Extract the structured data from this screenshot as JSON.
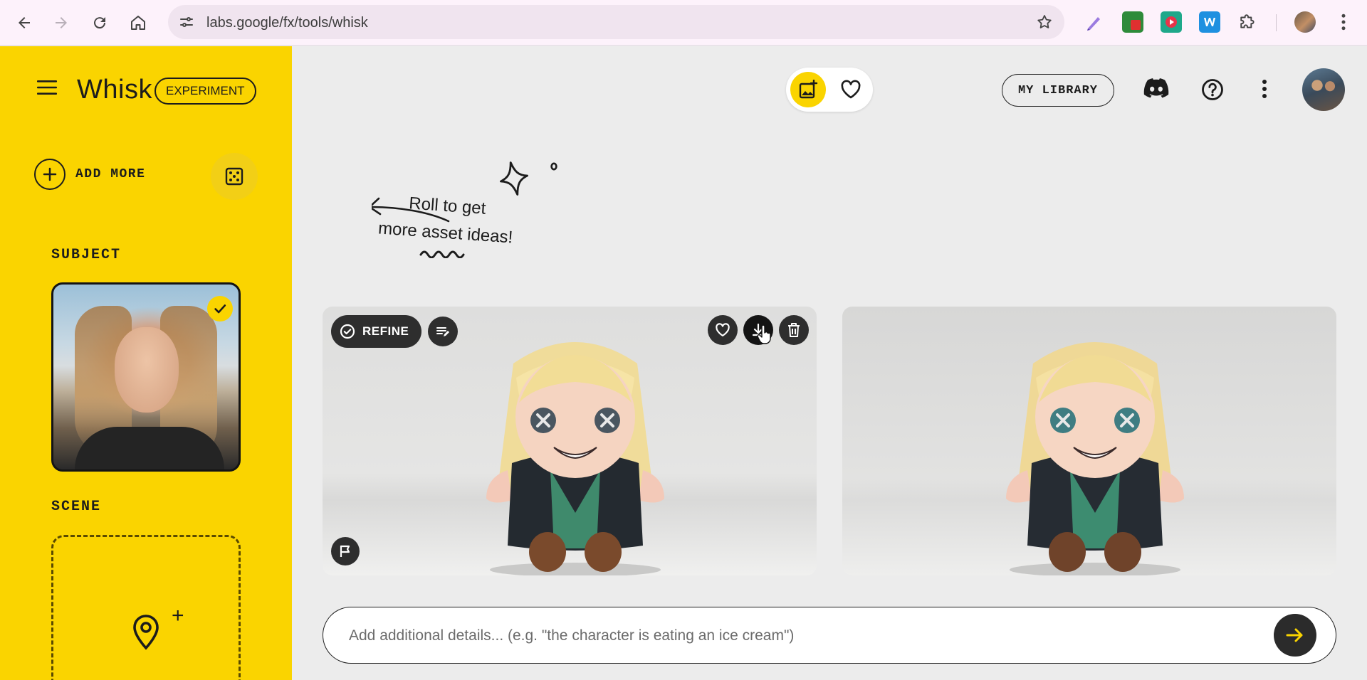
{
  "browser": {
    "url": "labs.google/fx/tools/whisk"
  },
  "app": {
    "title": "Whisk",
    "badge": "EXPERIMENT"
  },
  "sidebar": {
    "add_more_label": "ADD MORE",
    "subject_label": "SUBJECT",
    "scene_label": "SCENE"
  },
  "header": {
    "library_label": "MY LIBRARY"
  },
  "hint": {
    "line1": "Roll to get",
    "line2": "more asset ideas!"
  },
  "results": {
    "refine_label": "REFINE"
  },
  "prompt": {
    "placeholder": "Add additional details... (e.g. \"the character is eating an ice cream\")"
  },
  "colors": {
    "accent": "#fad400",
    "dark": "#2e2e2e",
    "background": "#ececec"
  },
  "icons": {
    "back": "arrow-left-icon",
    "forward": "arrow-right-icon",
    "reload": "reload-icon",
    "home": "home-icon",
    "site_info": "tune-icon",
    "bookmark": "star-icon",
    "extensions": "puzzle-icon",
    "menu": "hamburger-icon",
    "dice": "dice-icon",
    "discord": "discord-icon",
    "help": "help-icon",
    "more": "more-vert-icon",
    "favorite": "heart-icon",
    "download": "download-icon",
    "delete": "trash-icon",
    "report": "flag-icon",
    "location": "location-pin-icon",
    "send": "arrow-right-icon"
  }
}
